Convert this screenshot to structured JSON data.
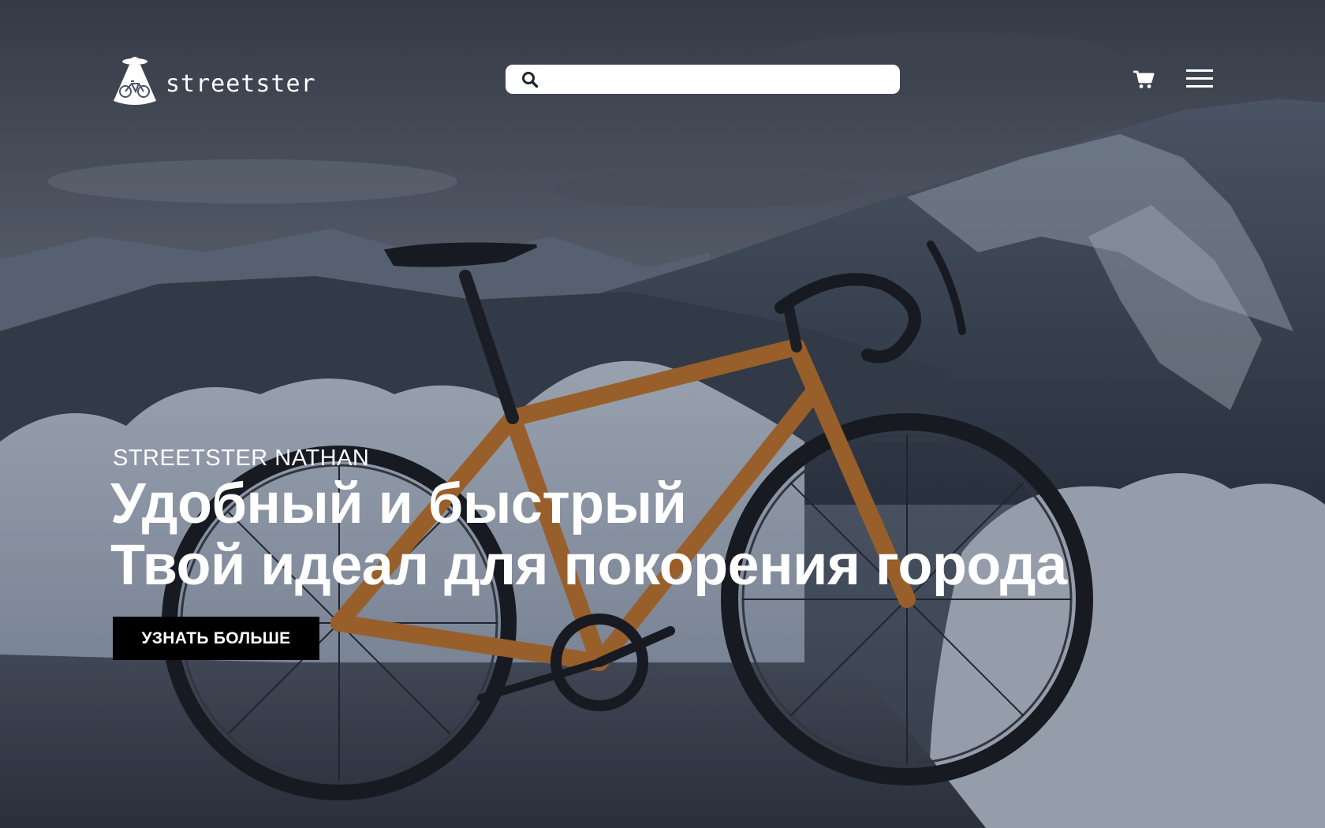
{
  "brand": {
    "name": "streetster",
    "logo_icon": "ufo-bicycle-logo-icon"
  },
  "search": {
    "icon": "search-icon",
    "value": "",
    "placeholder": ""
  },
  "header_actions": {
    "cart_icon": "cart-icon",
    "menu_icon": "hamburger-menu-icon"
  },
  "hero": {
    "eyebrow": "STREETSTER NATHAN",
    "headline_line1": "Удобный и быстрый",
    "headline_line2": "Твой идеал для покорения города",
    "cta_label": "УЗНАТЬ БОЛЬШЕ",
    "background": "bicycle-in-snowy-mountains-photo"
  },
  "colors": {
    "text": "#ffffff",
    "cta_background": "#000000",
    "search_background": "#ffffff",
    "bike_frame": "#c8782a"
  }
}
